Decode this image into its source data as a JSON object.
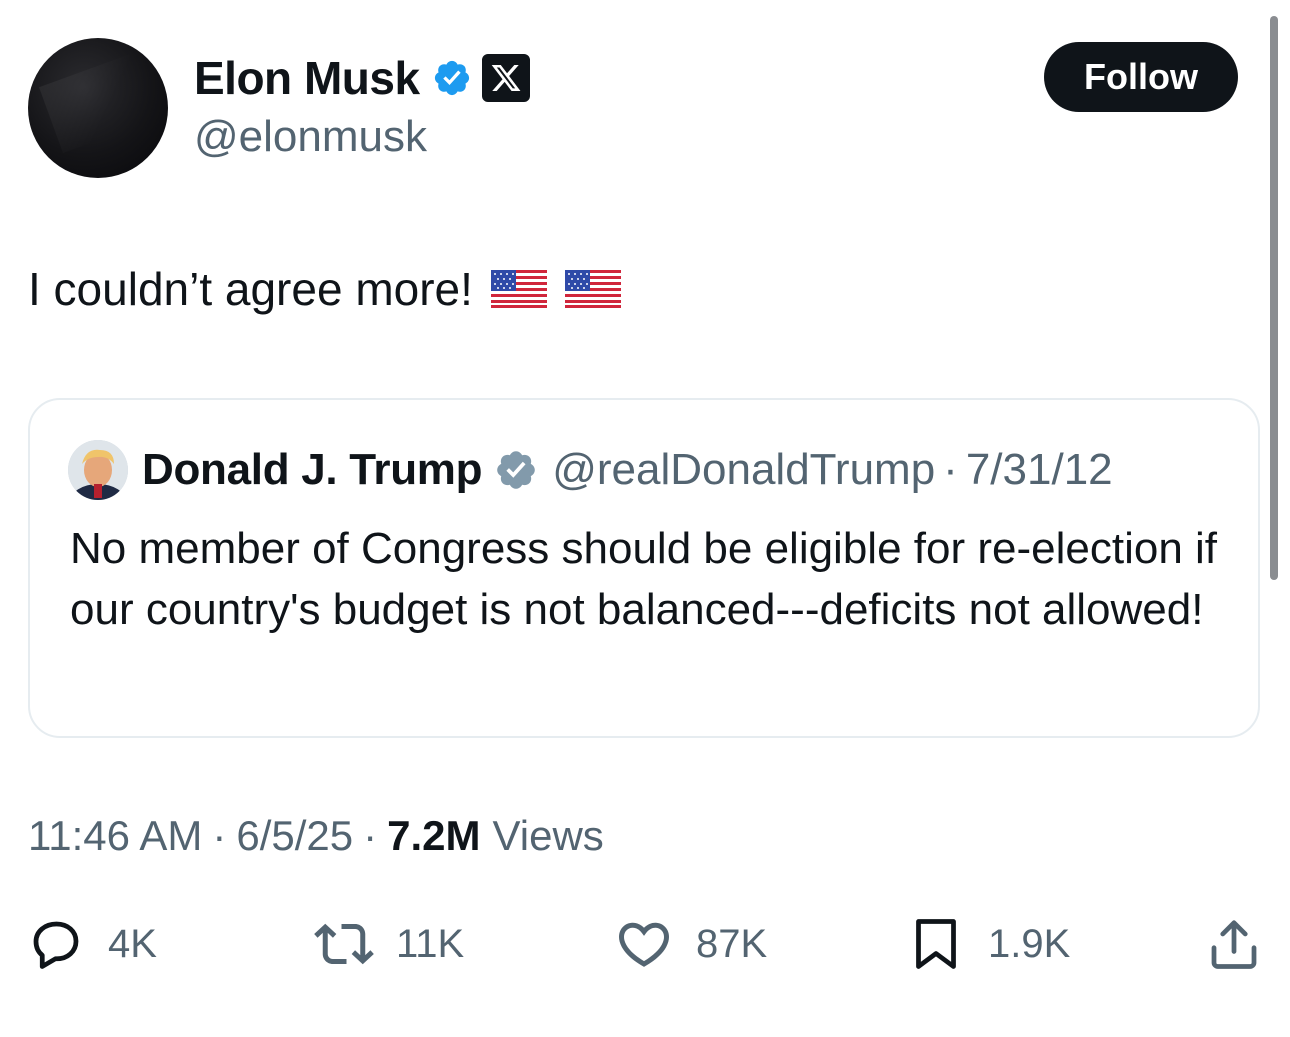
{
  "author": {
    "display_name": "Elon Musk",
    "handle": "@elonmusk"
  },
  "follow_label": "Follow",
  "tweet": {
    "text": "I couldn’t agree more!"
  },
  "quote": {
    "display_name": "Donald J. Trump",
    "handle": "@realDonaldTrump",
    "separator": "·",
    "date": "7/31/12",
    "text": "No member of Congress should be eligible for re-election if our country's budget is not balanced---deficits not allowed!"
  },
  "meta": {
    "time": "11:46 AM",
    "date": "6/5/25",
    "separator": "·",
    "views_count": "7.2M",
    "views_label": "Views"
  },
  "actions": {
    "replies": "4K",
    "reposts": "11K",
    "likes": "87K",
    "bookmarks": "1.9K"
  },
  "colors": {
    "text_primary": "#0f1419",
    "text_secondary": "#536471",
    "verified_blue": "#1d9bf0",
    "verified_gray": "#829aab",
    "border": "#e6ecf0"
  },
  "icons": {
    "verified": "verified-badge-icon",
    "affiliation": "x-logo-icon",
    "reply": "reply-icon",
    "repost": "repost-icon",
    "like": "heart-icon",
    "bookmark": "bookmark-icon",
    "share": "share-icon",
    "flag": "us-flag-icon"
  }
}
